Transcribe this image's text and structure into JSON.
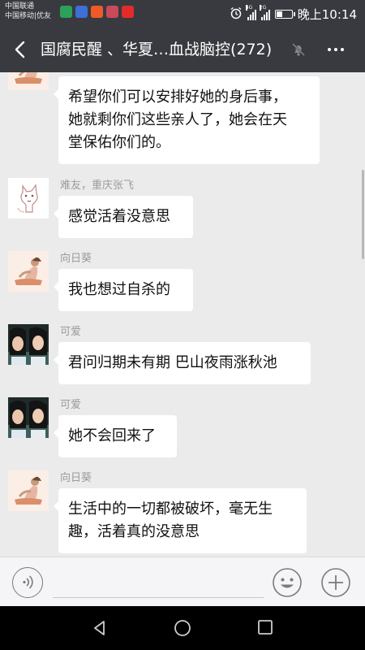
{
  "status_bar": {
    "carrier_1": "中国联通",
    "carrier_2": "中国移动|优友",
    "notification_icons": [
      {
        "name": "gameplay-app-icon",
        "color": "#2aa05b"
      },
      {
        "name": "browser-app-icon",
        "color": "#3d6fd6"
      },
      {
        "name": "video-app-icon",
        "color": "#f05a28"
      },
      {
        "name": "gallery-app-icon",
        "color": "#c94a5a"
      },
      {
        "name": "youku-app-icon",
        "color": "#e32b2b"
      }
    ],
    "signal_1_tag": "4G",
    "signal_2_tag": "2G",
    "battery_level": 0.4,
    "time": "晚上10:14"
  },
  "nav_bar": {
    "title": "国腐民醒 、华夏…血战脑控(272)"
  },
  "messages": [
    {
      "sender": "",
      "avatar": "woman-yoga-avatar",
      "text_lines": [
        "希望你们可以安排好她的身后事，",
        "她就剩你们这些亲人了，她会在天",
        "堂保佑你们的。"
      ]
    },
    {
      "sender": "难友，重庆张飞",
      "avatar": "fox-sketch-avatar",
      "text_lines": [
        "感觉活着没意思"
      ]
    },
    {
      "sender": "向日葵",
      "avatar": "woman-yoga-avatar",
      "text_lines": [
        "我也想过自杀的"
      ]
    },
    {
      "sender": "可爱",
      "avatar": "two-girls-photo-avatar",
      "text_lines": [
        "君问归期未有期 巴山夜雨涨秋池"
      ]
    },
    {
      "sender": "可爱",
      "avatar": "two-girls-photo-avatar",
      "text_lines": [
        "她不会回来了"
      ]
    },
    {
      "sender": "向日葵",
      "avatar": "woman-yoga-avatar",
      "text_lines": [
        "生活中的一切都被破坏，毫无生",
        "趣，活着真的没意思"
      ]
    }
  ],
  "input_bar": {
    "value": "",
    "placeholder": ""
  },
  "colors": {
    "header_bg": "#393a3f",
    "chat_bg": "#ebebeb",
    "bubble_bg": "#ffffff",
    "sender_text": "#9b9b9b"
  }
}
